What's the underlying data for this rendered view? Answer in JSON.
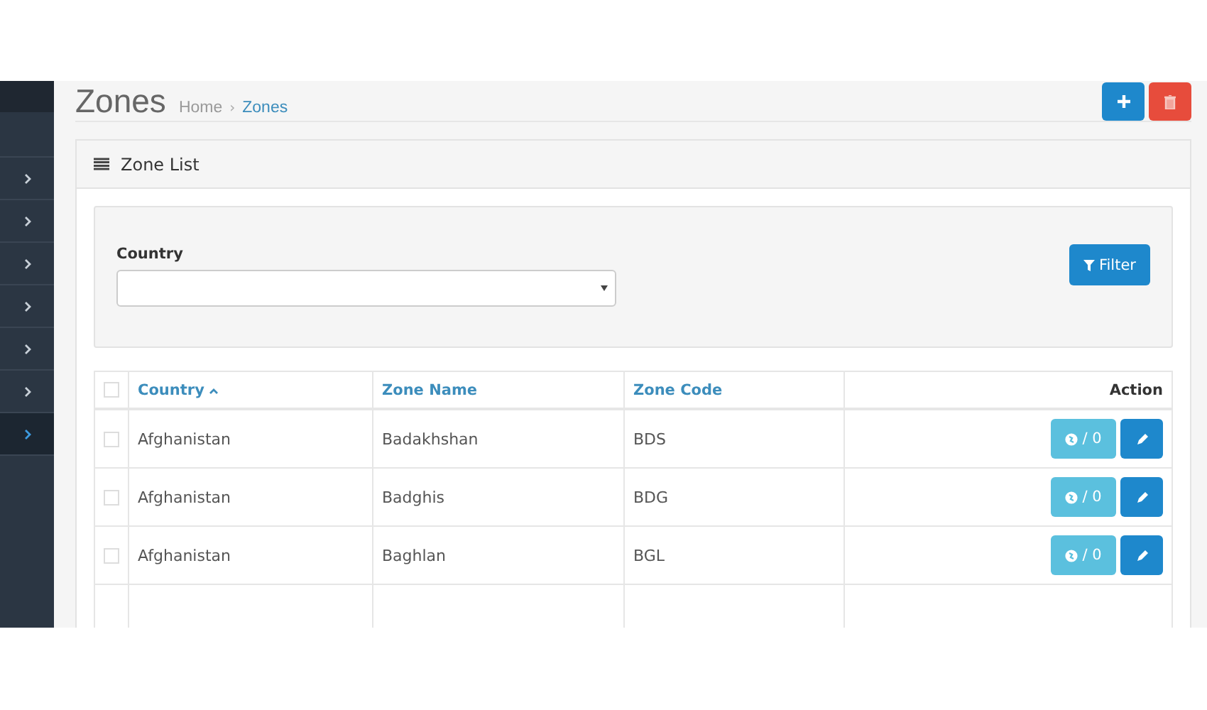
{
  "sidebar": {
    "items": [
      {
        "selected": false
      },
      {
        "selected": false
      },
      {
        "selected": false
      },
      {
        "selected": false
      },
      {
        "selected": false
      },
      {
        "selected": false
      },
      {
        "selected": true
      }
    ]
  },
  "page": {
    "title": "Zones",
    "breadcrumb": [
      "Home",
      "Zones"
    ],
    "breadcrumb_separator": "›"
  },
  "panel": {
    "title": "Zone List"
  },
  "filter": {
    "label": "Country",
    "button": "Filter"
  },
  "table": {
    "header_checked": false,
    "columns": [
      {
        "label": "Country",
        "sorted": true
      },
      {
        "label": "Zone Name",
        "sorted": false
      },
      {
        "label": "Zone Code",
        "sorted": false
      },
      {
        "label": "Action",
        "sorted": false
      }
    ],
    "rows": [
      {
        "checked": false,
        "country": "Afghanistan",
        "zone_name": "Badakhshan",
        "zone_code": "BDS",
        "count": "/ 0"
      },
      {
        "checked": false,
        "country": "Afghanistan",
        "zone_name": "Badghis",
        "zone_code": "BDG",
        "count": "/ 0"
      },
      {
        "checked": false,
        "country": "Afghanistan",
        "zone_name": "Baghlan",
        "zone_code": "BGL",
        "count": "/ 0"
      }
    ]
  }
}
